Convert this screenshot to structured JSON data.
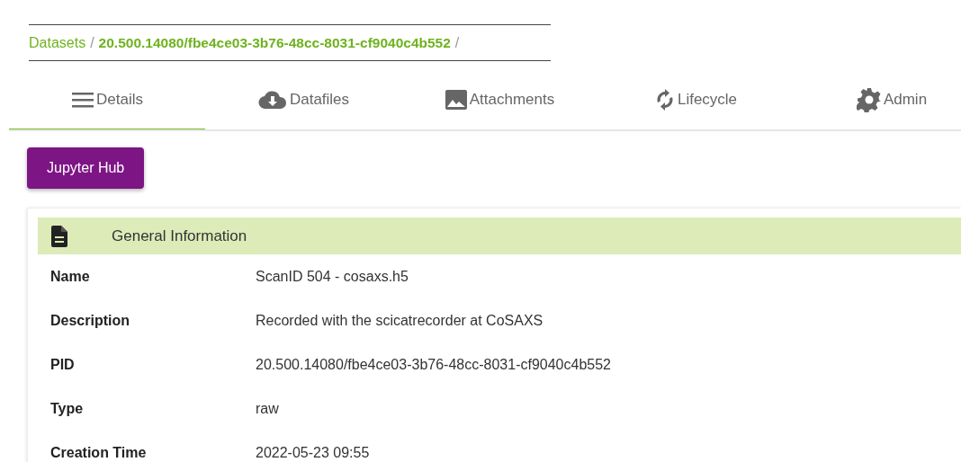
{
  "breadcrumb": [
    {
      "label": "Datasets",
      "current": false
    },
    {
      "label": "20.500.14080/fbe4ce03-3b76-48cc-8031-cf9040c4b552",
      "current": true
    }
  ],
  "separator": "/",
  "tabs": [
    {
      "label": "Details",
      "selected": true
    },
    {
      "label": "Datafiles",
      "selected": false
    },
    {
      "label": "Attachments",
      "selected": false
    },
    {
      "label": "Lifecycle",
      "selected": false
    },
    {
      "label": "Admin",
      "selected": false
    }
  ],
  "action_button": "Jupyter Hub",
  "section": {
    "title": "General Information",
    "fields": [
      {
        "label": "Name",
        "value": "ScanID 504 - cosaxs.h5"
      },
      {
        "label": "Description",
        "value": "Recorded with the scicatrecorder at CoSAXS"
      },
      {
        "label": "PID",
        "value": "20.500.14080/fbe4ce03-3b76-48cc-8031-cf9040c4b552"
      },
      {
        "label": "Type",
        "value": "raw"
      },
      {
        "label": "Creation Time",
        "value": "2022-05-23 09:55"
      }
    ]
  }
}
